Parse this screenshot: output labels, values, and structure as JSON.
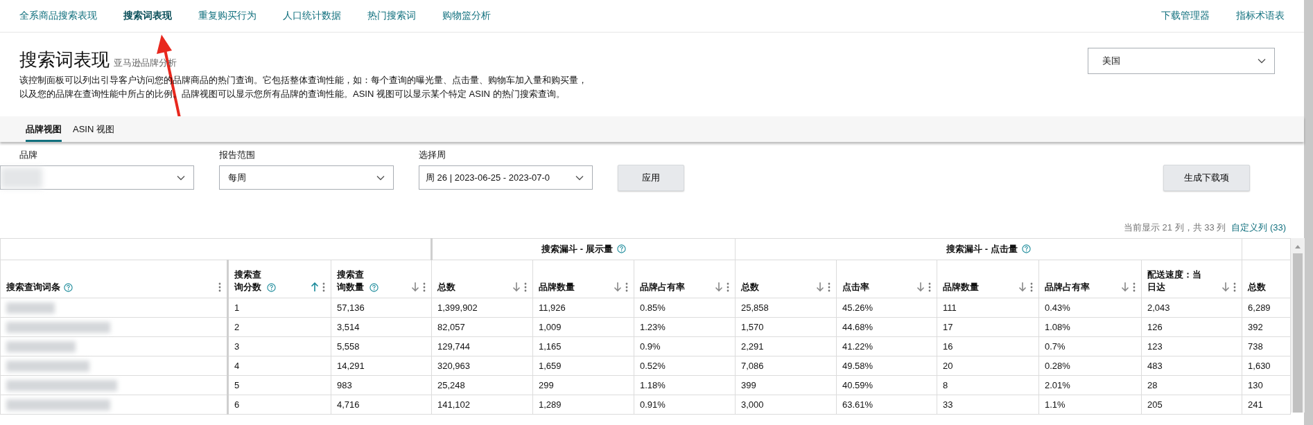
{
  "top_nav": {
    "items": [
      {
        "label": "全系商品搜索表现",
        "selected": false
      },
      {
        "label": "搜索词表现",
        "selected": true
      },
      {
        "label": "重复购买行为",
        "selected": false
      },
      {
        "label": "人口统计数据",
        "selected": false
      },
      {
        "label": "热门搜索词",
        "selected": false
      },
      {
        "label": "购物篮分析",
        "selected": false
      }
    ],
    "right_links": [
      "下载管理器",
      "指标术语表"
    ]
  },
  "header": {
    "title": "搜索词表现",
    "subtitle": "亚马逊品牌分析",
    "description_lines": [
      "该控制面板可以列出引导客户访问您的品牌商品的热门查询。它包括整体查询性能，如：每个查询的曝光量、点击量、购物车加入量和购买量，",
      "以及您的品牌在查询性能中所占的比例。品牌视图可以显示您所有品牌的查询性能。ASIN 视图可以显示某个特定 ASIN 的热门搜索查询。"
    ],
    "marketplace": "美国"
  },
  "view_tabs": [
    {
      "label": "品牌视图",
      "selected": true
    },
    {
      "label": "ASIN 视图",
      "selected": false
    }
  ],
  "filters": [
    {
      "label": "品牌",
      "blurred": true
    },
    {
      "label": "报告范围",
      "value": "每周",
      "blurred": false
    },
    {
      "label": "选择周",
      "value": "周 26 | 2023-06-25 - 2023-07-0",
      "blurred": false
    }
  ],
  "apply_button": "应用",
  "download_button": "生成下载项",
  "columns_info": {
    "text": "当前显示 21 列，共 33 列",
    "link": "自定义列 (33)"
  },
  "table": {
    "groups": [
      {
        "help": false
      },
      {
        "label": "搜索漏斗 - 展示量",
        "help": true
      },
      {
        "label": "搜索漏斗 - 点击量",
        "help": true
      },
      {
        "help": false
      }
    ],
    "columns": [
      {
        "label": "搜索查询词条",
        "help": true,
        "sortable": false,
        "sorted": false
      },
      {
        "label": "搜索查询分数",
        "help": true,
        "sortable": true,
        "sorted": true
      },
      {
        "label": "搜索查询数量",
        "help": true,
        "sortable": true,
        "sorted": false
      },
      {
        "label": "总数",
        "help": false,
        "sortable": true,
        "sorted": false
      },
      {
        "label": "品牌数量",
        "help": false,
        "sortable": true,
        "sorted": false
      },
      {
        "label": "品牌占有率",
        "help": false,
        "sortable": true,
        "sorted": false
      },
      {
        "label": "总数",
        "help": false,
        "sortable": true,
        "sorted": false
      },
      {
        "label": "点击率",
        "help": false,
        "sortable": true,
        "sorted": false
      },
      {
        "label": "品牌数量",
        "help": false,
        "sortable": true,
        "sorted": false
      },
      {
        "label": "品牌占有率",
        "help": false,
        "sortable": true,
        "sorted": false
      },
      {
        "label": "配送速度：当日达",
        "help": false,
        "sortable": true,
        "sorted": false
      },
      {
        "label": "总数",
        "help": false,
        "sortable": false,
        "sorted": false
      }
    ],
    "rows": [
      {
        "query_blurred": true,
        "cells": [
          "",
          "1",
          "57,136",
          "1,399,902",
          "11,926",
          "0.85%",
          "25,858",
          "45.26%",
          "111",
          "0.43%",
          "2,043",
          "6,289"
        ]
      },
      {
        "query_blurred": true,
        "cells": [
          "",
          "2",
          "3,514",
          "82,057",
          "1,009",
          "1.23%",
          "1,570",
          "44.68%",
          "17",
          "1.08%",
          "126",
          "392"
        ]
      },
      {
        "query_blurred": true,
        "cells": [
          "",
          "3",
          "5,558",
          "129,744",
          "1,165",
          "0.9%",
          "2,291",
          "41.22%",
          "16",
          "0.7%",
          "123",
          "738"
        ]
      },
      {
        "query_blurred": true,
        "cells": [
          "",
          "4",
          "14,291",
          "320,963",
          "1,659",
          "0.52%",
          "7,086",
          "49.58%",
          "20",
          "0.28%",
          "483",
          "1,630"
        ]
      },
      {
        "query_blurred": true,
        "cells": [
          "",
          "5",
          "983",
          "25,248",
          "299",
          "1.18%",
          "399",
          "40.59%",
          "8",
          "2.01%",
          "28",
          "130"
        ]
      },
      {
        "query_blurred": true,
        "cells": [
          "",
          "6",
          "4,716",
          "141,102",
          "1,289",
          "0.91%",
          "3,000",
          "63.61%",
          "33",
          "1.1%",
          "205",
          "241"
        ]
      }
    ]
  }
}
